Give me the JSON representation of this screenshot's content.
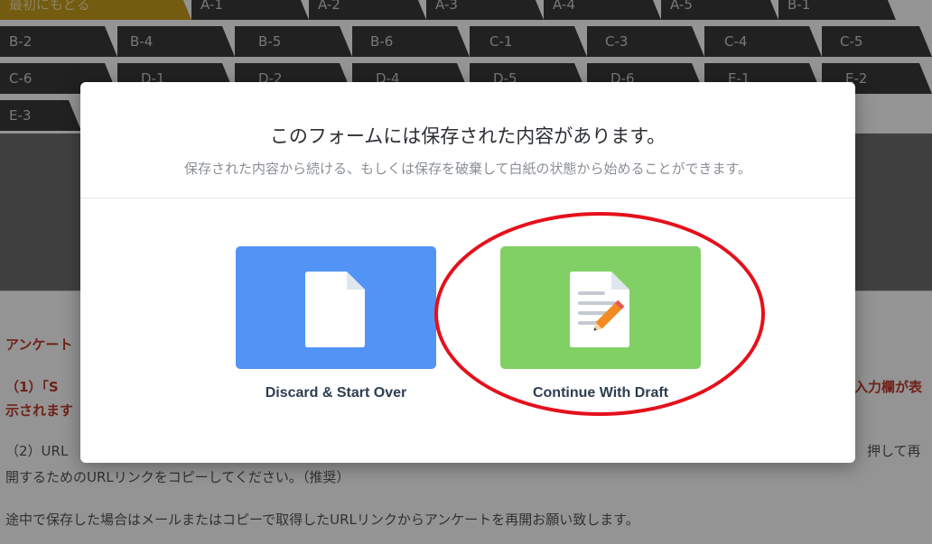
{
  "nav": {
    "row0": [
      "最初にもどる",
      "A-1",
      "A-2",
      "A-3",
      "A-4",
      "A-5",
      "B-1"
    ],
    "row1": [
      "B-2",
      "B-4",
      "B-5",
      "B-6",
      "C-1",
      "C-3",
      "C-4",
      "C-5"
    ],
    "row2": [
      "C-6",
      "D-1",
      "D-2",
      "D-4",
      "D-5",
      "D-6",
      "E-1",
      "E-2"
    ],
    "row3": [
      "E-3"
    ]
  },
  "page": {
    "survey_heading": "アンケート",
    "step1_a": "（1）「S",
    "step1_b": "入力欄が表",
    "step1_c": "示されます",
    "step2_a": "（2）URL",
    "step2_b": "押して再",
    "step2_c": "開するためのURLリンクをコピーしてください。（推奨）",
    "step3": "途中で保存した場合はメールまたはコピーで取得したURLリンクからアンケートを再開お願い致します。"
  },
  "modal": {
    "title": "このフォームには保存された内容があります。",
    "subtitle": "保存された内容から続ける、もしくは保存を破棄して白紙の状態から始めることができます。",
    "discard_label": "Discard & Start Over",
    "continue_label": "Continue With Draft"
  },
  "colors": {
    "discard_bg": "#5294f5",
    "continue_bg": "#81d065",
    "highlight": "#e5101b"
  },
  "icons": {
    "discard": "blank-document-icon",
    "continue": "edit-document-icon"
  }
}
